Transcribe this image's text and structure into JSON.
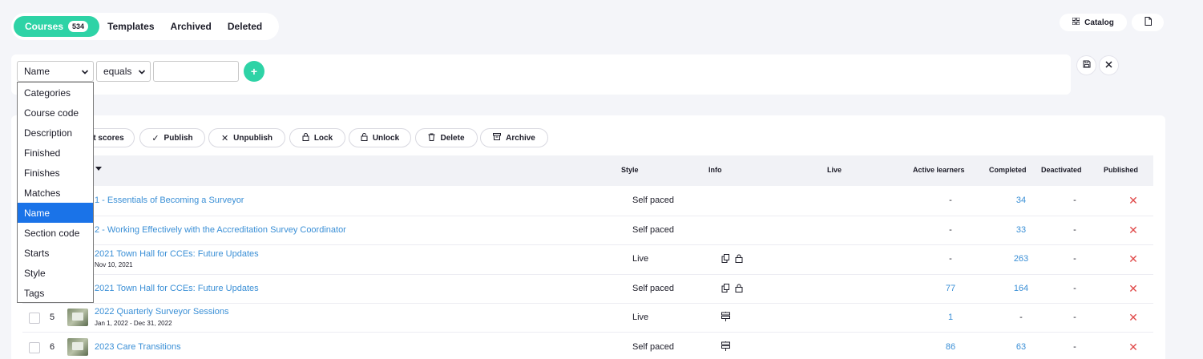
{
  "tabs": {
    "courses": "Courses",
    "courses_count": "534",
    "templates": "Templates",
    "archived": "Archived",
    "deleted": "Deleted"
  },
  "top_buttons": {
    "catalog": "Catalog"
  },
  "filter": {
    "field_value": "Name",
    "operator_value": "equals",
    "text_value": "",
    "add_label": "+"
  },
  "dropdown": {
    "options": [
      "Categories",
      "Course code",
      "Description",
      "Finished",
      "Finishes",
      "Matches",
      "Name",
      "Section code",
      "Starts",
      "Style",
      "Tags"
    ],
    "selected": "Name"
  },
  "actions": {
    "scores": "t scores",
    "publish": "Publish",
    "unpublish": "Unpublish",
    "lock": "Lock",
    "unlock": "Unlock",
    "delete": "Delete",
    "archive": "Archive"
  },
  "table": {
    "headers": {
      "style": "Style",
      "info": "Info",
      "live": "Live",
      "active_learners": "Active learners",
      "completed": "Completed",
      "deactivated": "Deactivated",
      "published": "Published"
    },
    "rows": [
      {
        "num": "",
        "title": "1 - Essentials of Becoming a Surveyor",
        "date": "",
        "style": "Self paced",
        "info": "",
        "active": "-",
        "completed": "34",
        "deactivated": "-",
        "published": "✕"
      },
      {
        "num": "",
        "title": "2 - Working Effectively with the Accreditation Survey Coordinator",
        "date": "",
        "style": "Self paced",
        "info": "",
        "active": "-",
        "completed": "33",
        "deactivated": "-",
        "published": "✕"
      },
      {
        "num": "",
        "title": "2021 Town Hall for CCEs: Future Updates",
        "date": "Nov 10, 2021",
        "style": "Live",
        "info": "⎘ 🔒",
        "active": "-",
        "completed": "263",
        "deactivated": "-",
        "published": "✕"
      },
      {
        "num": "",
        "title": "2021 Town Hall for CCEs: Future Updates",
        "date": "",
        "style": "Self paced",
        "info": "⎘ 🔒",
        "active": "77",
        "completed": "164",
        "deactivated": "-",
        "published": "✕"
      },
      {
        "num": "5",
        "title": "2022 Quarterly Surveyor Sessions",
        "date": "Jan 1, 2022 - Dec 31, 2022",
        "style": "Live",
        "info": "⊟",
        "active": "1",
        "completed": "-",
        "deactivated": "-",
        "published": "✕"
      },
      {
        "num": "6",
        "title": "2023 Care Transitions",
        "date": "",
        "style": "Self paced",
        "info": "⊟",
        "active": "86",
        "completed": "63",
        "deactivated": "-",
        "published": "✕"
      }
    ]
  },
  "colors": {
    "accent": "#2ed3a6",
    "link": "#3a8fd6",
    "error": "#e04a4a",
    "selected": "#1a73e8"
  }
}
